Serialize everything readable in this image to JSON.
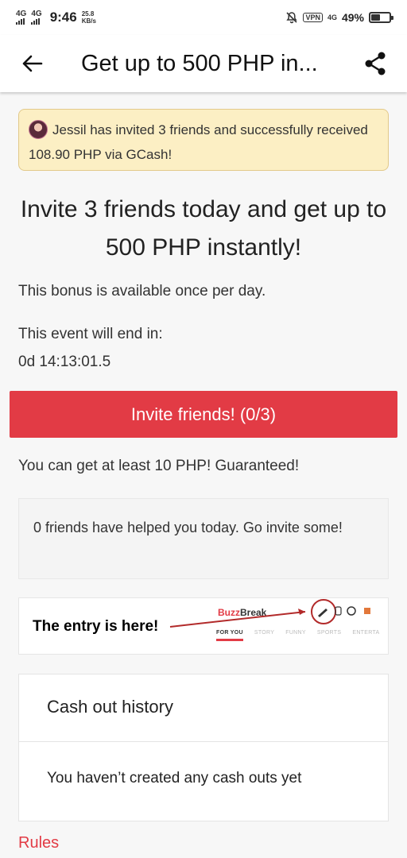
{
  "status_bar": {
    "net1": "4G",
    "net2": "4G",
    "time": "9:46",
    "speed_value": "25.8",
    "speed_unit": "KB/s",
    "vpn": "VPN",
    "net3": "4G",
    "battery_pct": "49%",
    "battery_level": 0.49
  },
  "app_bar": {
    "title": "Get up to 500 PHP in...",
    "back_icon": "back-arrow-icon",
    "share_icon": "share-icon"
  },
  "banner": {
    "text": "Jessil has invited 3 friends and successfully received 108.90 PHP via GCash!"
  },
  "headline": "Invite 3 friends today and get up to 500 PHP instantly!",
  "bonus_note": "This bonus is available once per day.",
  "event_label": "This event will end in:",
  "countdown": "0d 14:13:01.5",
  "invite_button": "Invite friends! (0/3)",
  "guarantee": "You can get at least 10 PHP! Guaranteed!",
  "helped": "0 friends have helped you today. Go invite some!",
  "entry_image": {
    "caption": "The entry is here!",
    "brand_a": "Buzz",
    "brand_b": "Break",
    "tabs": [
      "FOR YOU",
      "STORY",
      "FUNNY",
      "SPORTS",
      "ENTERTA"
    ]
  },
  "cash_out": {
    "title": "Cash out history",
    "empty": "You haven’t created any cash outs yet"
  },
  "rules": "Rules",
  "colors": {
    "accent": "#e23b45",
    "banner_bg": "#fcefc4"
  }
}
